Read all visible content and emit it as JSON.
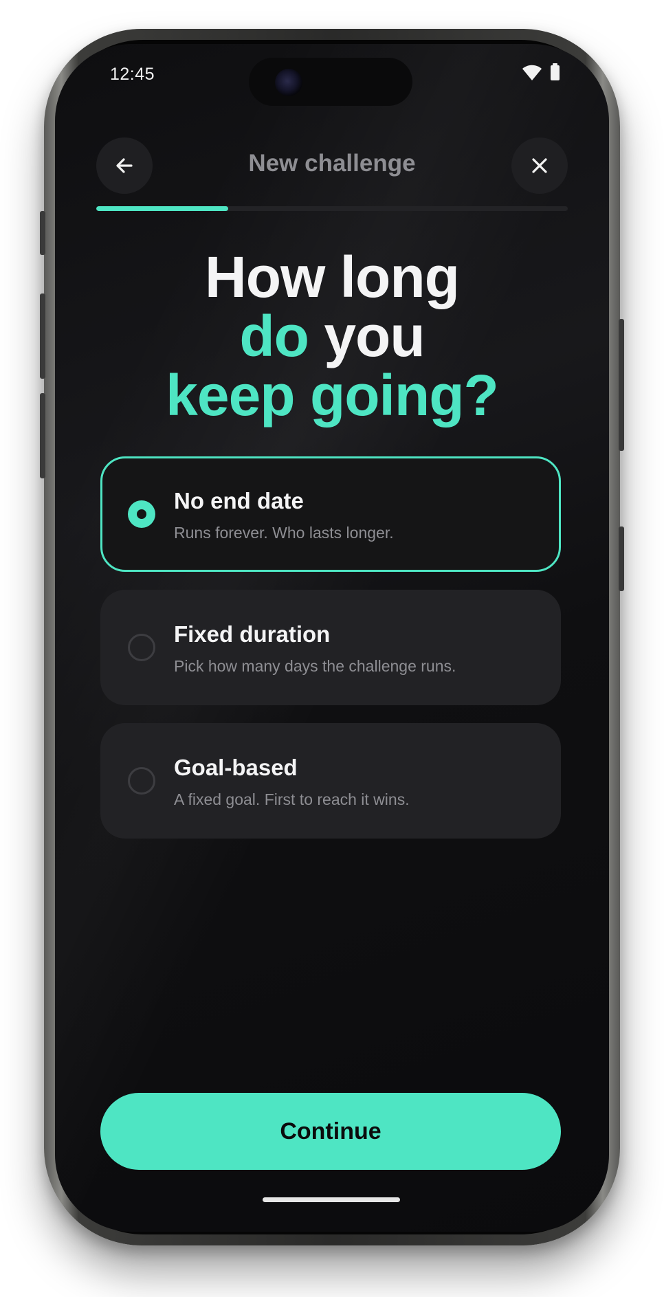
{
  "status_bar": {
    "time": "12:45",
    "wifi_icon": "wifi-icon",
    "battery_icon": "battery-icon"
  },
  "header": {
    "title": "New challenge",
    "back_icon": "arrow-left-icon",
    "close_icon": "close-icon",
    "progress_fraction": 0.28
  },
  "headline": {
    "line1": "How long",
    "line2_a": "do",
    "line2_b": "you",
    "line3": "keep going?"
  },
  "options": [
    {
      "title": "No end date",
      "description": "Runs forever. Who lasts longer.",
      "selected": true
    },
    {
      "title": "Fixed duration",
      "description": "Pick how many days the challenge runs.",
      "selected": false
    },
    {
      "title": "Goal-based",
      "description": "A fixed goal. First to reach it wins.",
      "selected": false
    }
  ],
  "continue_label": "Continue",
  "colors": {
    "accent": "#4ee5c3",
    "background": "#0e0e10",
    "card": "#222225"
  }
}
